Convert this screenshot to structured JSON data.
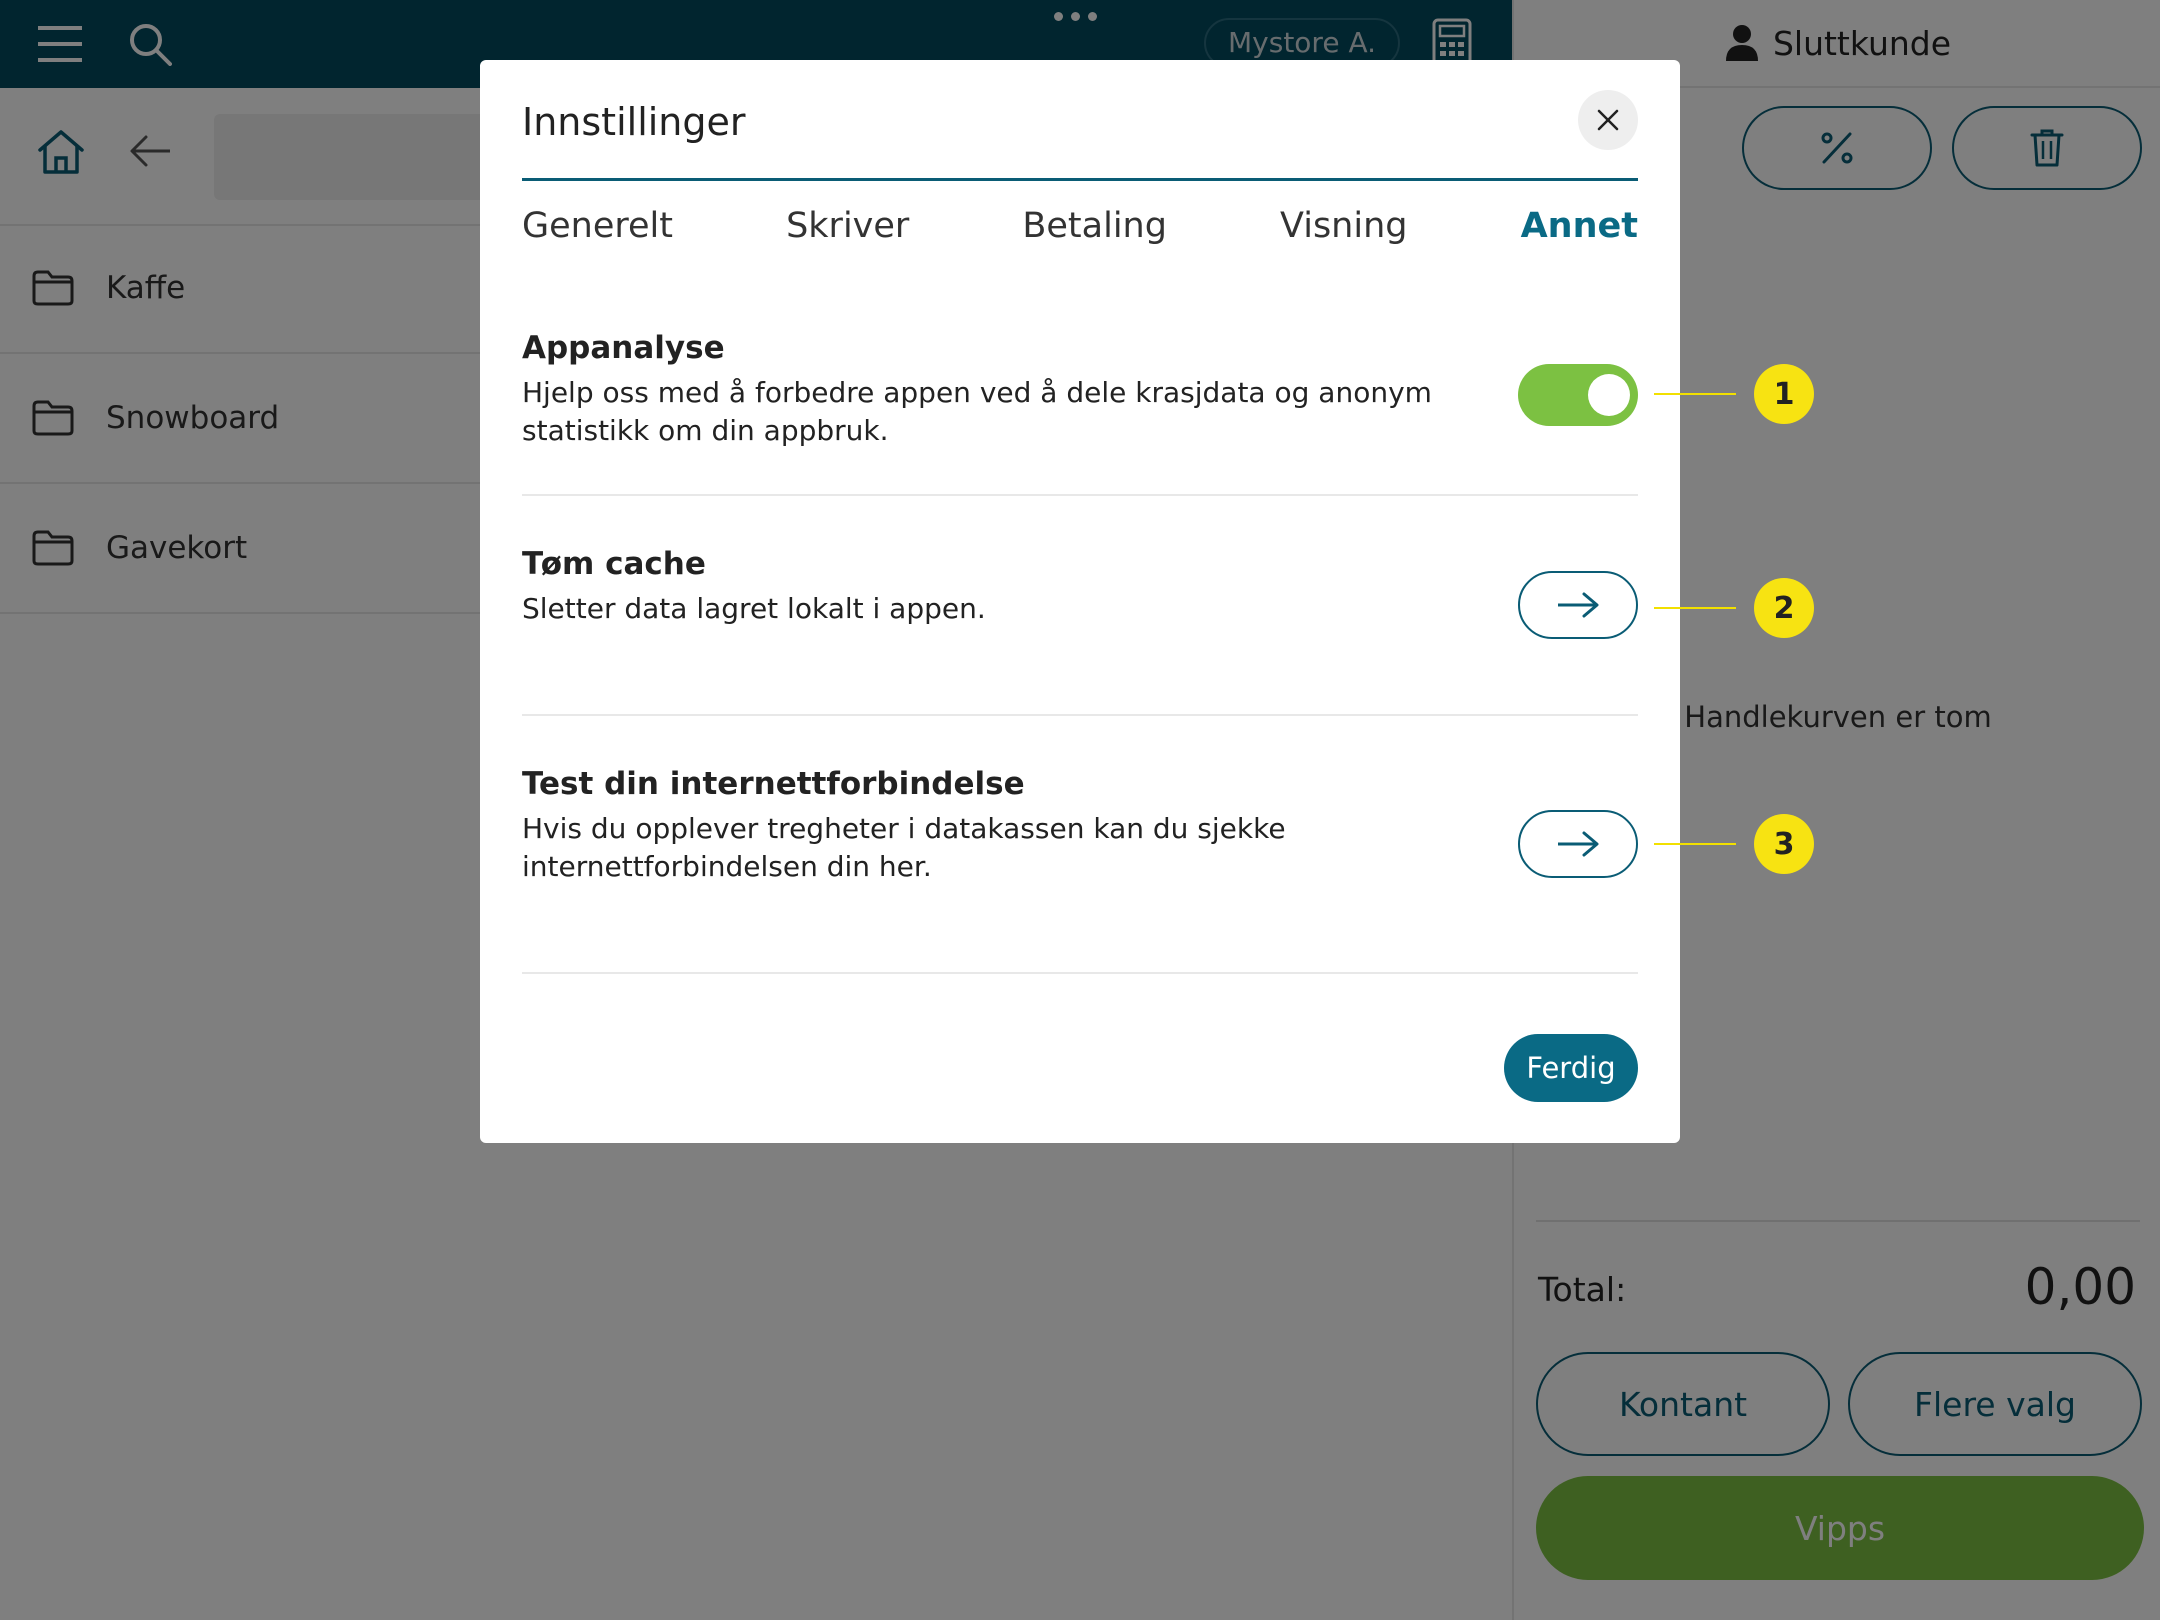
{
  "topbar": {
    "menu_icon": "hamburger-icon",
    "search_icon": "search-icon",
    "more_icon": "more-dots-icon",
    "store_label": "Mystore A.",
    "calculator_icon": "calculator-icon"
  },
  "navbar": {
    "home_icon": "home-icon",
    "back_icon": "arrow-left-icon"
  },
  "categories": [
    {
      "label": "Kaffe",
      "icon": "folder-icon"
    },
    {
      "label": "Snowboard",
      "icon": "folder-icon"
    },
    {
      "label": "Gavekort",
      "icon": "folder-icon"
    }
  ],
  "sidebar": {
    "customer_label": "Sluttkunde",
    "customer_icon": "user-icon",
    "discount_icon": "percent-icon",
    "delete_icon": "trash-icon",
    "empty_cart": "Handlekurven er tom",
    "total_label": "Total:",
    "total_value": "0,00",
    "cash_button": "Kontant",
    "more_options_button": "Flere valg",
    "vipps_button": "Vipps"
  },
  "dialog": {
    "title": "Innstillinger",
    "close_icon": "close-icon",
    "tabs": [
      {
        "label": "Generelt",
        "active": false
      },
      {
        "label": "Skriver",
        "active": false
      },
      {
        "label": "Betaling",
        "active": false
      },
      {
        "label": "Visning",
        "active": false
      },
      {
        "label": "Annet",
        "active": true
      }
    ],
    "settings": [
      {
        "title": "Appanalyse",
        "description": "Hjelp oss med å forbedre appen ved å dele krasjdata og anonym statistikk om din appbruk.",
        "control": "toggle",
        "enabled": true
      },
      {
        "title": "Tøm cache",
        "description": "Sletter data lagret lokalt i appen.",
        "control": "arrow-button"
      },
      {
        "title": "Test din internettforbindelse",
        "description": "Hvis du opplever tregheter i datakassen kan du sjekke internettforbindelsen din her.",
        "control": "arrow-button"
      }
    ],
    "done_button": "Ferdig"
  },
  "callouts": [
    "1",
    "2",
    "3"
  ],
  "colors": {
    "brand_dark": "#034a5e",
    "brand_accent": "#0a6a85",
    "toggle_on": "#7cc142",
    "callout": "#f7e312",
    "vipps": "#7cc142"
  }
}
